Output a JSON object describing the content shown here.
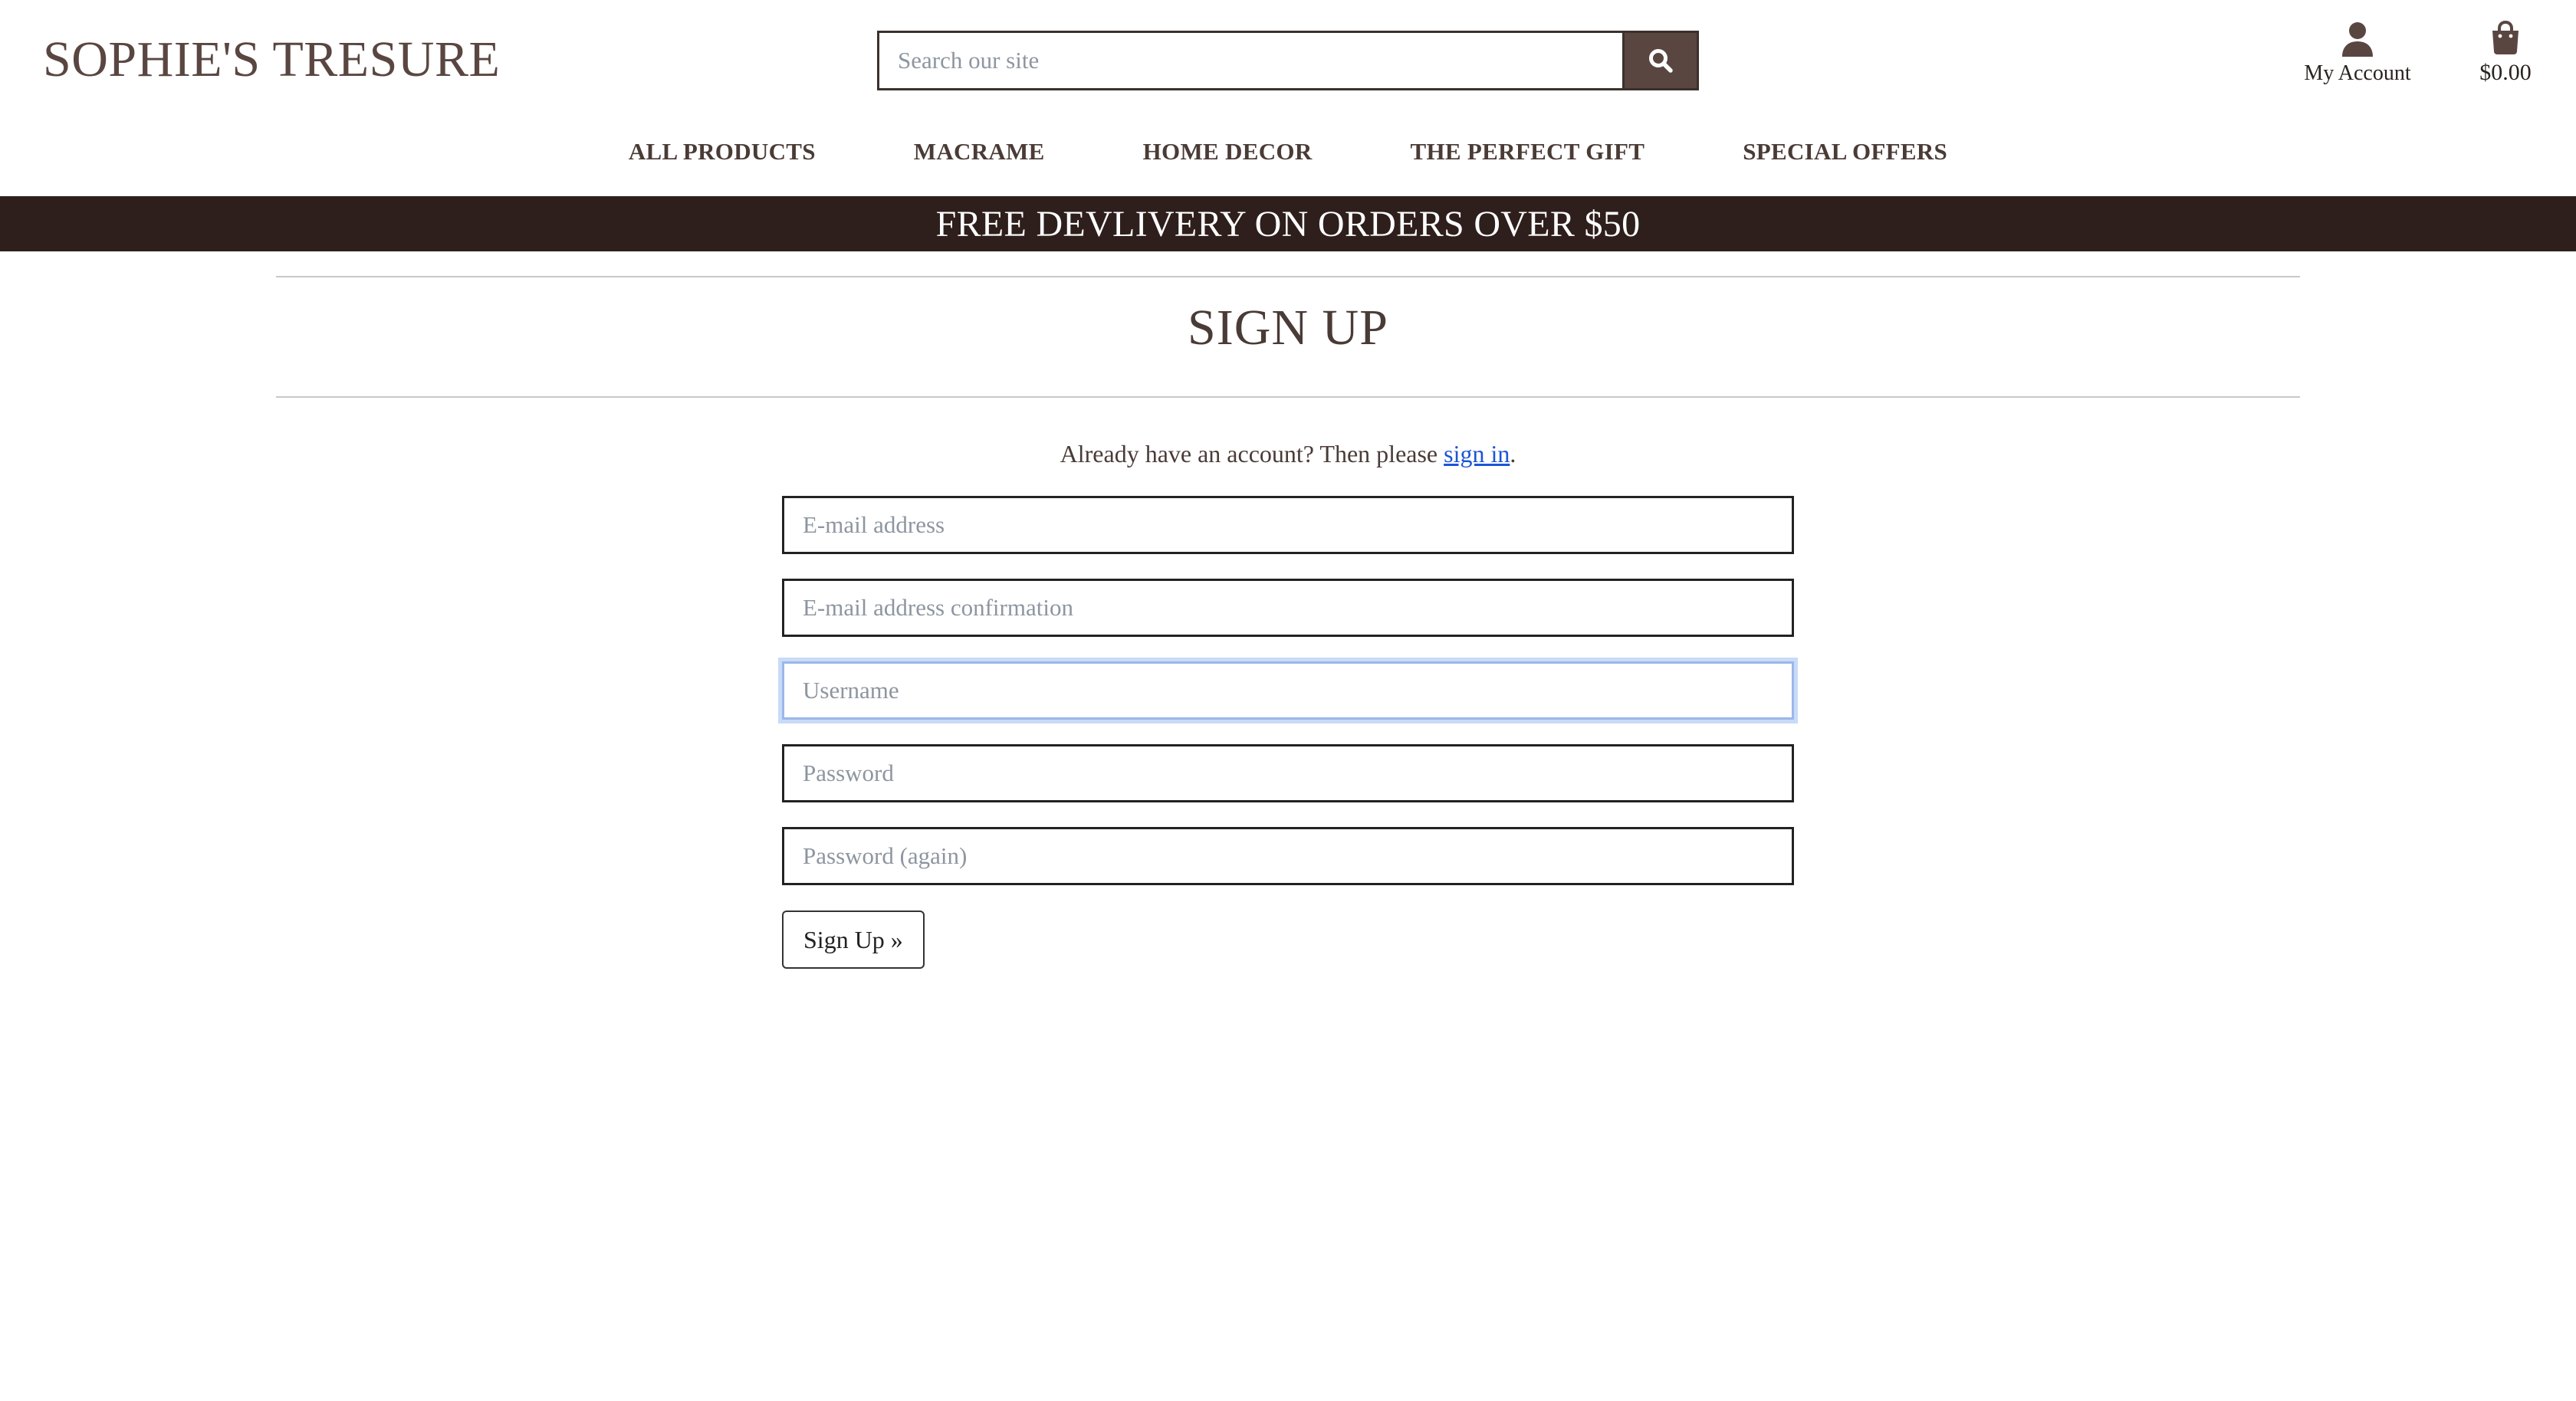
{
  "header": {
    "brand": "SOPHIE'S TRESURE",
    "search": {
      "placeholder": "Search our site",
      "value": "",
      "button_icon": "search-icon"
    },
    "account": {
      "label": "My Account",
      "icon": "user-icon"
    },
    "cart": {
      "total": "$0.00",
      "icon": "shopping-bag-icon"
    }
  },
  "nav": {
    "items": [
      {
        "label": "ALL PRODUCTS"
      },
      {
        "label": "MACRAME"
      },
      {
        "label": "HOME DECOR"
      },
      {
        "label": "THE PERFECT GIFT"
      },
      {
        "label": "SPECIAL OFFERS"
      }
    ]
  },
  "banner": {
    "text": "FREE DEVLIVERY ON ORDERS OVER $50"
  },
  "page": {
    "title": "SIGN UP",
    "prompt_before": "Already have an account? Then please ",
    "prompt_link": "sign in",
    "prompt_after": "."
  },
  "form": {
    "email_placeholder": "E-mail address",
    "email_confirm_placeholder": "E-mail address confirmation",
    "username_placeholder": "Username",
    "password_placeholder": "Password",
    "password_again_placeholder": "Password (again)",
    "submit_label": "Sign Up »",
    "focused_field": "username"
  },
  "colors": {
    "brand_brown": "#5a4641",
    "banner_bg": "#2e1f1c",
    "link_blue": "#1a56d6",
    "focus_ring": "#c8dbf7"
  }
}
